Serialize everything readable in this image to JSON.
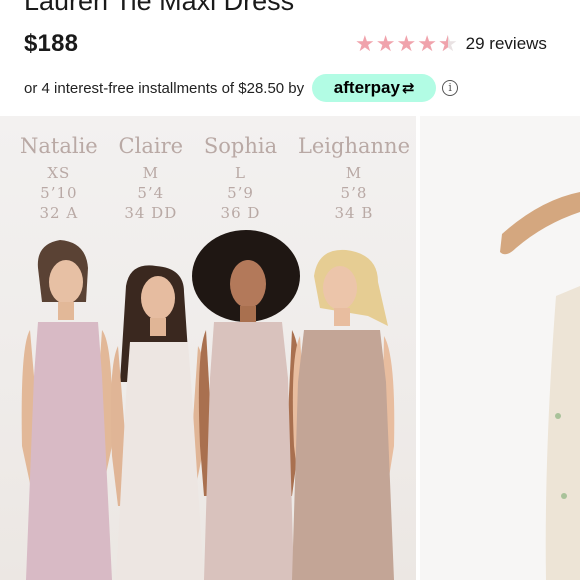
{
  "product": {
    "title": "Lauren Tie Maxi Dress",
    "price": "$188",
    "rating_value": 4.5,
    "rating_max": 5,
    "reviews_label": "29 reviews"
  },
  "installments": {
    "text": "or 4 interest-free installments of $28.50 by",
    "afterpay_label": "afterpay",
    "afterpay_logo": "⇄",
    "info_icon": "i"
  },
  "colors": {
    "star": "#f0a3ac",
    "afterpay_bg": "#b2fce4",
    "chart_text": "#b9a9a5",
    "dress_mauve": "#d8bac5",
    "dress_ivory": "#ede6e2",
    "dress_blush": "#d9c2bd",
    "dress_taupe": "#c3a596"
  },
  "size_chart": [
    {
      "name": "Natalie",
      "size": "XS",
      "height": "5’10",
      "bra": "32 A"
    },
    {
      "name": "Claire",
      "size": "M",
      "height": "5’4",
      "bra": "34 DD"
    },
    {
      "name": "Sophia",
      "size": "L",
      "height": "5’9",
      "bra": "36 D"
    },
    {
      "name": "Leighanne",
      "size": "M",
      "height": "5’8",
      "bra": "34 B"
    }
  ]
}
